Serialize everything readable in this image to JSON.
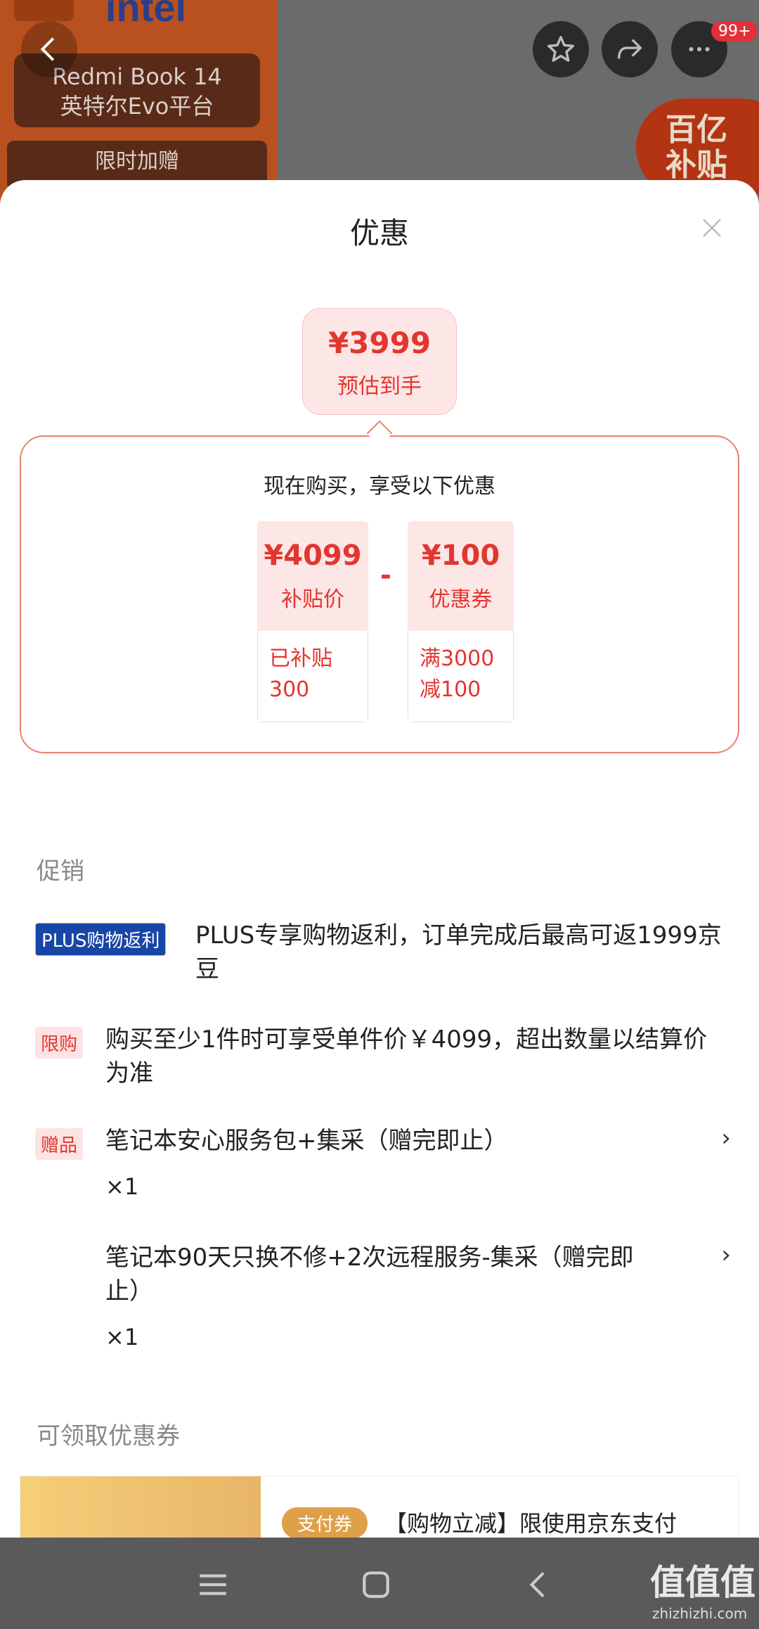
{
  "background": {
    "product_name_line1": "Redmi Book 14",
    "product_name_line2": "英特尔Evo平台",
    "promo_pill": "限时加赠",
    "brand": "intel",
    "notification_badge": "99+",
    "subsidy_badge_line1": "百亿",
    "subsidy_badge_line2": "补贴"
  },
  "sheet": {
    "title": "优惠",
    "estimate": {
      "price": "¥3999",
      "label": "预估到手"
    },
    "calc_heading": "现在购买，享受以下优惠",
    "items": [
      {
        "price": "¥4099",
        "label": "补贴价",
        "detail_line1": "已补贴",
        "detail_line2": "300"
      },
      {
        "price": "¥100",
        "label": "优惠券",
        "detail_line1": "满3000",
        "detail_line2": "减100"
      }
    ],
    "operator": "-"
  },
  "promotions": {
    "section_label": "促销",
    "rows": [
      {
        "tag": "PLUS购物返利",
        "text": "PLUS专享购物返利，订单完成后最高可返1999京豆"
      },
      {
        "tag": "限购",
        "text": "购买至少1件时可享受单件价￥4099，超出数量以结算价为准"
      },
      {
        "tag": "赠品",
        "text": "笔记本安心服务包+集采（赠完即止）",
        "qty": "×1",
        "chevron": "›"
      },
      {
        "tag": "",
        "text": "笔记本90天只换不修+2次远程服务-集采（赠完即止）",
        "qty": "×1",
        "chevron": "›"
      }
    ]
  },
  "coupons": {
    "section_label": "可领取优惠券",
    "first": {
      "tag": "支付券",
      "text": "【购物立减】限使用京东支付"
    }
  },
  "watermark": {
    "main": "值值值",
    "sub": "zhizhizhi.com"
  },
  "colors": {
    "accent": "#e2362f",
    "plus_blue": "#1846a7",
    "coupon_gold": "#e0a04a"
  }
}
